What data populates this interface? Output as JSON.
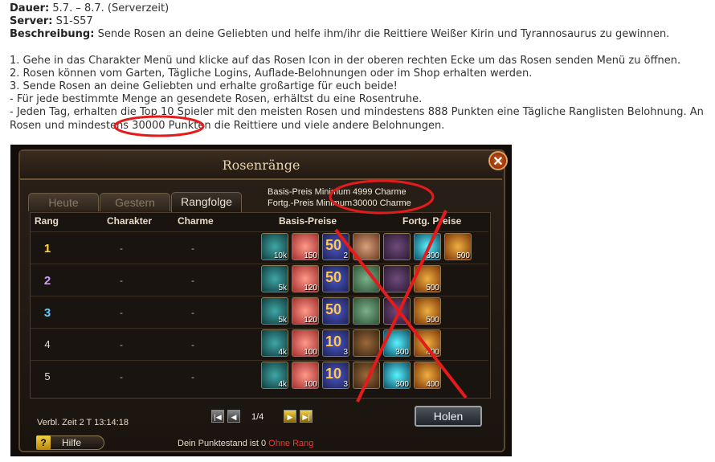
{
  "header": {
    "dauer_label": "Dauer:",
    "dauer_value": "5.7. – 8.7. (Serverzeit)",
    "server_label": "Server:",
    "server_value": "S1-S57",
    "beschreibung_label": "Beschreibung:",
    "beschreibung_value": "Sende Rosen an deine Geliebten und helfe ihm/ihr die Reittiere Weißer Kirin und Tyrannosaurus zu gewinnen."
  },
  "steps": [
    "1. Gehe in das Charakter Menü und klicke auf das Rosen Icon in der oberen rechten Ecke um das Rosen senden Menü zu öffnen.",
    "2. Rosen können vom Garten, Tägliche Logins, Auflade-Belohnungen oder im Shop erhalten werden.",
    "3. Sende Rosen an deine Geliebten und erhalte großartige für euch beide!",
    "- Für jede bestimmte Menge an gesendete Rosen, erhältst du eine Rosentruhe.",
    "- Jeden Tag, erhalten die Top 10 Spieler mit den meisten Rosen und mindestens 888 Punkten eine Tägliche Ranglisten Belohnung. An",
    "Rosen und mindestens 30000 Punkten die Reittiere und viele andere Belohnungen."
  ],
  "game": {
    "title": "Rosenränge",
    "close_glyph": "✕",
    "tabs": [
      "Heute",
      "Gestern",
      "Rangfolge"
    ],
    "active_tab": "Rangfolge",
    "price_info": {
      "basis_label": "Basis-Preis Minimum",
      "basis_value": "4999 Charme",
      "fortg_label": "Fortg.-Preis Minimum",
      "fortg_value": "30000 Charme"
    },
    "columns": [
      "Rang",
      "Charakter",
      "Charme",
      "Basis-Preise",
      "Fortg. Preise"
    ],
    "rows": [
      {
        "rank": "1",
        "charakter": "-",
        "charme": "-",
        "items": [
          {
            "icon": "teal-emblem-icon",
            "qty": "10k"
          },
          {
            "icon": "rose-bundle-icon",
            "qty": "150"
          },
          {
            "icon": "number-50-icon",
            "qty": "2",
            "big": "50"
          },
          {
            "icon": "face-icon",
            "qty": ""
          },
          {
            "icon": "kirin-icon",
            "qty": ""
          },
          {
            "icon": "orb-icon",
            "qty": "300"
          },
          {
            "icon": "gold-chest-icon",
            "qty": "500"
          }
        ]
      },
      {
        "rank": "2",
        "charakter": "-",
        "charme": "-",
        "items": [
          {
            "icon": "teal-emblem-icon",
            "qty": "5k"
          },
          {
            "icon": "rose-bundle-icon",
            "qty": "120"
          },
          {
            "icon": "number-50-icon",
            "qty": "",
            "big": "50"
          },
          {
            "icon": "girl-portrait-icon",
            "qty": ""
          },
          {
            "icon": "kirin-icon",
            "qty": ""
          },
          {
            "icon": "gold-chest-icon",
            "qty": "500"
          }
        ]
      },
      {
        "rank": "3",
        "charakter": "-",
        "charme": "-",
        "items": [
          {
            "icon": "teal-emblem-icon",
            "qty": "5k"
          },
          {
            "icon": "rose-bundle-icon",
            "qty": "120"
          },
          {
            "icon": "number-50-icon",
            "qty": "",
            "big": "50"
          },
          {
            "icon": "girl-portrait-icon",
            "qty": ""
          },
          {
            "icon": "kirin-icon",
            "qty": ""
          },
          {
            "icon": "gold-chest-icon",
            "qty": "500"
          }
        ]
      },
      {
        "rank": "4",
        "charakter": "-",
        "charme": "-",
        "items": [
          {
            "icon": "teal-emblem-icon",
            "qty": "4k"
          },
          {
            "icon": "rose-bundle-icon",
            "qty": "100"
          },
          {
            "icon": "number-10-icon",
            "qty": "3",
            "big": "10"
          },
          {
            "icon": "dino-icon",
            "qty": ""
          },
          {
            "icon": "orb-icon",
            "qty": "300"
          },
          {
            "icon": "gold-chest-icon",
            "qty": "400"
          }
        ]
      },
      {
        "rank": "5",
        "charakter": "-",
        "charme": "-",
        "items": [
          {
            "icon": "teal-emblem-icon",
            "qty": "4k"
          },
          {
            "icon": "rose-bundle-icon",
            "qty": "100"
          },
          {
            "icon": "number-10-icon",
            "qty": "3",
            "big": "10"
          },
          {
            "icon": "dino-icon",
            "qty": ""
          },
          {
            "icon": "orb-icon",
            "qty": "300"
          },
          {
            "icon": "gold-chest-icon",
            "qty": "400"
          }
        ]
      }
    ],
    "time_remaining": "Verbl. Zeit 2 T  13:14:18",
    "page": "1/4",
    "pager_glyphs": [
      "|◀",
      "◀",
      "▶",
      "▶|"
    ],
    "holen_label": "Holen",
    "help_label": "Hilfe",
    "help_glyph": "?",
    "status_prefix": "Dein Punktestand ist  0",
    "status_red": "Ohne Rang"
  },
  "colors": {
    "annotation_red": "#e31b1b"
  }
}
